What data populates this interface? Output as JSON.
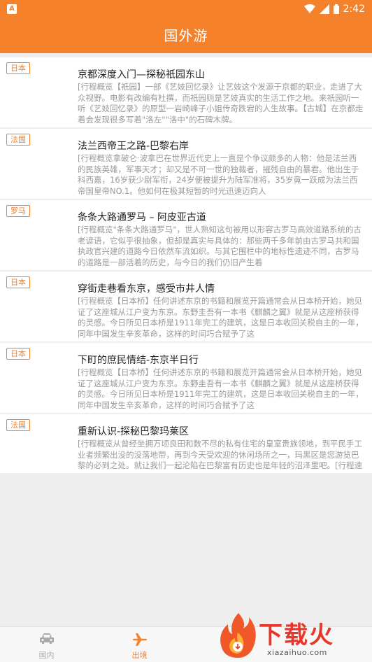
{
  "status_bar": {
    "left_icon": "A",
    "time": "2:42",
    "icons": [
      "wifi-icon",
      "signal-icon",
      "battery-icon"
    ]
  },
  "header": {
    "title": "国外游"
  },
  "colors": {
    "accent": "#f5822b",
    "title_text": "#222222",
    "desc_text": "#999999"
  },
  "trips": [
    {
      "tag": "日本",
      "title": "京都深度入门—探秘祇园东山",
      "desc": "[行程概览【祇园】一部《艺妓回忆录》让艺妓这个发源于京都的职业，走进了大众视野。电影有改编有杜撰，而祇园则是艺妓真实的生活工作之地。来祇园听一听《艺妓回忆录》的原型一岩崎峰子小姐传奇跌宕的人生故事。【古城】在京都走着会发现很多写着\"洛左\"\"洛中\"的石碑木牌。"
    },
    {
      "tag": "法国",
      "title": "法兰西帝王之路-巴黎右岸",
      "desc": "[行程概览拿破仑·波拿巴在世界近代史上一直是个争议颇多的人物：他是法兰西的民族英雄，军事天才；却又是不可一世的独裁者，摧残自由的暴君。他出生于科西嘉，16岁获少尉军衔，24岁便被提升为陆军准将，35岁竟一跃成为法兰西帝国皇帝NO.1。他如何在极其短暂的时光迅速迈向人"
    },
    {
      "tag": "罗马",
      "title": "条条大路通罗马 – 阿皮亚古道",
      "desc": "[行程概览\"条条大路通罗马\"，世人熟知这句被用以形容古罗马高效道路系统的古老谚语，它似乎很抽象，但却是真实与具体的：那些两千多年前由古罗马共和国执政官兴建的道路今日依然车流如织。与其它围栏中的地标性遗迹不同，古罗马的道路是一部活着的历史，与今日的我们仍旧产生着"
    },
    {
      "tag": "日本",
      "title": "穿街走巷看东京，感受市井人情",
      "desc": "[行程概览【日本桥】任何讲述东京的书籍和展览开篇通常会从日本桥开始，她见证了这座城从江户变为东京。东野圭吾有一本书《麒麟之翼》就是从这座桥获得的灵感。今日所见日本桥是1911年完工的建筑，这是日本收回关税自主的一年，同年中国发生辛亥革命，这样的时间巧合赋予了这"
    },
    {
      "tag": "日本",
      "title": "下町的庶民情结-东京半日行",
      "desc": "[行程概览【日本桥】任何讲述东京的书籍和展览开篇通常会从日本桥开始，她见证了这座城从江户变为东京。东野圭吾有一本书《麒麟之翼》就是从这座桥获得的灵感。今日所见日本桥是1911年完工的建筑，这是日本收回关税自主的一年，同年中国发生辛亥革命，这样的时间巧合赋予了这"
    },
    {
      "tag": "法国",
      "title": "重新认识-探秘巴黎玛莱区",
      "desc": "[行程概览从曾经坐拥万顷良田和数不尽的私有住宅的皇室贵族领地，到平民手工业者频繁出没的没落地带，再到今天受欢迎的休闲场所之一，玛黑区是您游览巴黎的必到之处。就让我们一起沦陷在巴黎富有历史也是年轻的沼泽里吧。[行程速览]集合地点：地铁一号线SaintPaul站出站后地铁口"
    }
  ],
  "bottom_nav": {
    "items": [
      {
        "label": "国内",
        "icon": "car-icon",
        "active": false
      },
      {
        "label": "出境",
        "icon": "airplane-icon",
        "active": true
      }
    ]
  },
  "watermark": {
    "text": "下载火",
    "url": "xiazaihuo.com"
  }
}
